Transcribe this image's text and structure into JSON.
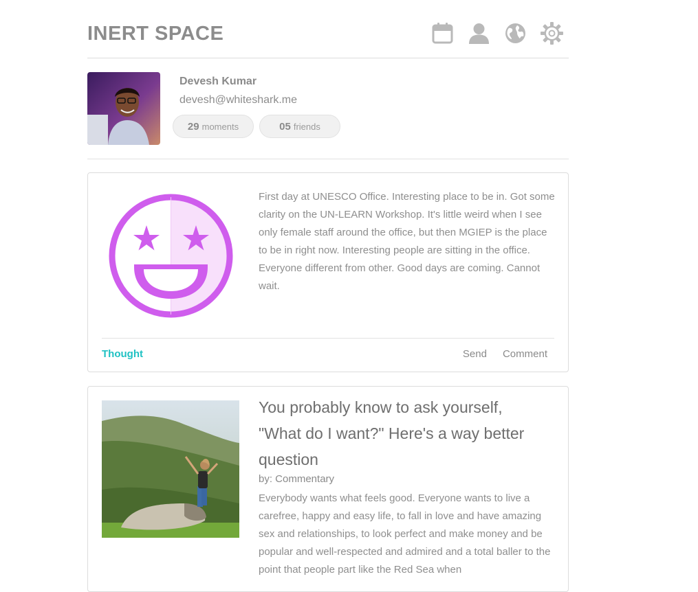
{
  "app": {
    "title": "INERT SPACE"
  },
  "nav": {
    "icons": [
      "calendar-icon",
      "user-icon",
      "globe-icon",
      "gear-icon"
    ]
  },
  "profile": {
    "name": "Devesh Kumar",
    "email": "devesh@whiteshark.me",
    "moments_count": "29",
    "moments_label": "moments",
    "friends_count": "05",
    "friends_label": "friends"
  },
  "posts": [
    {
      "text": "First day at UNESCO Office. Interesting place to be in. Got some clarity on the UN-LEARN Workshop. It's little weird when I see only female staff around the office, but then MGIEP is the place to be in right now. Interesting people are sitting in the office. Everyone different from other. Good days are coming. Cannot wait.",
      "tag": "Thought",
      "actions": {
        "send": "Send",
        "comment": "Comment"
      },
      "icon": "star-eyes-emoji-icon"
    },
    {
      "title": "You probably know to ask yourself, \"What do I want?\" Here's a way better question",
      "byline": "by: Commentary",
      "body": "Everybody wants what feels good. Everyone wants to live a carefree, happy and easy life, to fall in love and have amazing sex and relationships, to look perfect and make money and be popular and well-respected and admired and a total baller to the point that people part like the Red Sea when"
    }
  ],
  "colors": {
    "accent": "#1fc1c3",
    "emoji": "#cf5ded",
    "emoji_tint": "#f8e0fb",
    "icon": "#b9b9b9"
  }
}
